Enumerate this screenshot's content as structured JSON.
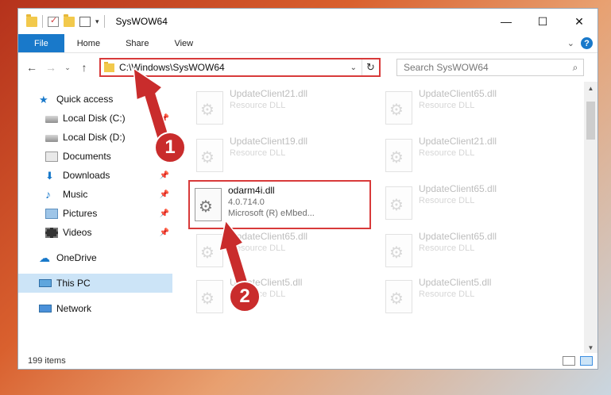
{
  "window": {
    "title": "SysWOW64",
    "buttons": {
      "minimize": "—",
      "maximize": "☐",
      "close": "✕"
    }
  },
  "ribbon": {
    "tabs": [
      "File",
      "Home",
      "Share",
      "View"
    ],
    "expand_glyph": "⌄",
    "help_glyph": "?"
  },
  "nav": {
    "back": "←",
    "forward": "→",
    "recent": "⌄",
    "up": "↑",
    "address": "C:\\Windows\\SysWOW64",
    "address_dropdown": "⌄",
    "refresh": "↻",
    "search_placeholder": "Search SysWOW64",
    "search_icon": "search-icon"
  },
  "sidebar": {
    "items": [
      {
        "label": "Quick access",
        "icon": "star-icon",
        "pinned": false
      },
      {
        "label": "Local Disk (C:)",
        "icon": "drive-icon",
        "pinned": true
      },
      {
        "label": "Local Disk (D:)",
        "icon": "drive-icon",
        "pinned": false
      },
      {
        "label": "Documents",
        "icon": "documents-icon",
        "pinned": false
      },
      {
        "label": "Downloads",
        "icon": "download-icon",
        "pinned": true
      },
      {
        "label": "Music",
        "icon": "music-icon",
        "pinned": true
      },
      {
        "label": "Pictures",
        "icon": "pictures-icon",
        "pinned": true
      },
      {
        "label": "Videos",
        "icon": "videos-icon",
        "pinned": true
      },
      {
        "label": "OneDrive",
        "icon": "cloud-icon",
        "pinned": false
      },
      {
        "label": "This PC",
        "icon": "computer-icon",
        "pinned": false
      },
      {
        "label": "Network",
        "icon": "network-icon",
        "pinned": false
      }
    ],
    "pin_glyph": "📌"
  },
  "files": [
    {
      "name": "UpdateClient21.dll",
      "meta1": "Resource DLL",
      "meta2": ""
    },
    {
      "name": "UpdateClient65.dll",
      "meta1": "Resource DLL",
      "meta2": ""
    },
    {
      "name": "UpdateClient19.dll",
      "meta1": "Resource DLL",
      "meta2": ""
    },
    {
      "name": "UpdateClient21.dll",
      "meta1": "Resource DLL",
      "meta2": ""
    },
    {
      "name": "odarm4i.dll",
      "meta1": "4.0.714.0",
      "meta2": "Microsoft (R) eMbed..."
    },
    {
      "name": "UpdateClient65.dll",
      "meta1": "Resource DLL",
      "meta2": ""
    },
    {
      "name": "UpdateClient65.dll",
      "meta1": "Resource DLL",
      "meta2": ""
    },
    {
      "name": "UpdateClient65.dll",
      "meta1": "Resource DLL",
      "meta2": ""
    },
    {
      "name": "UpdateClient5.dll",
      "meta1": "Resource DLL",
      "meta2": ""
    },
    {
      "name": "UpdateClient5.dll",
      "meta1": "Resource DLL",
      "meta2": ""
    }
  ],
  "status": {
    "item_count": "199 items"
  },
  "annotations": {
    "badge1": "1",
    "badge2": "2"
  },
  "colors": {
    "accent": "#1979ca",
    "highlight": "#d83a3a",
    "badge": "#c92c2c"
  }
}
